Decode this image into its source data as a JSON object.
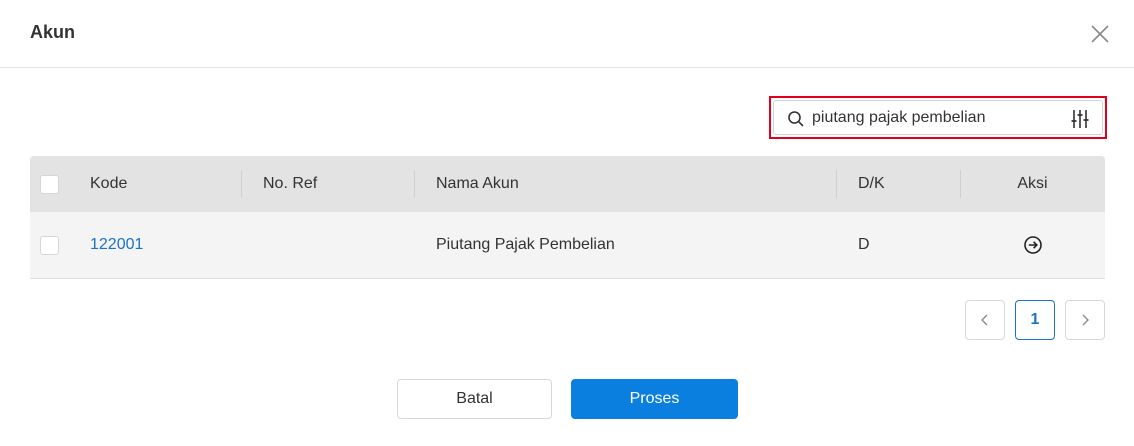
{
  "dialog": {
    "title": "Akun"
  },
  "search": {
    "value": "piutang pajak pembelian",
    "placeholder": ""
  },
  "table": {
    "columns": {
      "kode": "Kode",
      "ref": "No. Ref",
      "nama": "Nama Akun",
      "dk": "D/K",
      "aksi": "Aksi"
    },
    "rows": [
      {
        "kode": "122001",
        "ref": "",
        "nama": "Piutang Pajak Pembelian",
        "dk": "D"
      }
    ]
  },
  "pagination": {
    "current_page": "1"
  },
  "footer": {
    "cancel_label": "Batal",
    "submit_label": "Proses"
  },
  "colors": {
    "primary": "#0b7fe0",
    "link": "#1a73c8",
    "highlight_border": "#e0001b",
    "header_bg": "#e3e3e3",
    "row_bg": "#f4f4f4"
  },
  "icons": {
    "close": "close-icon",
    "search": "search-icon",
    "filter": "sliders-icon",
    "row_action": "arrow-circle-right-icon",
    "prev": "chevron-left-icon",
    "next": "chevron-right-icon"
  }
}
